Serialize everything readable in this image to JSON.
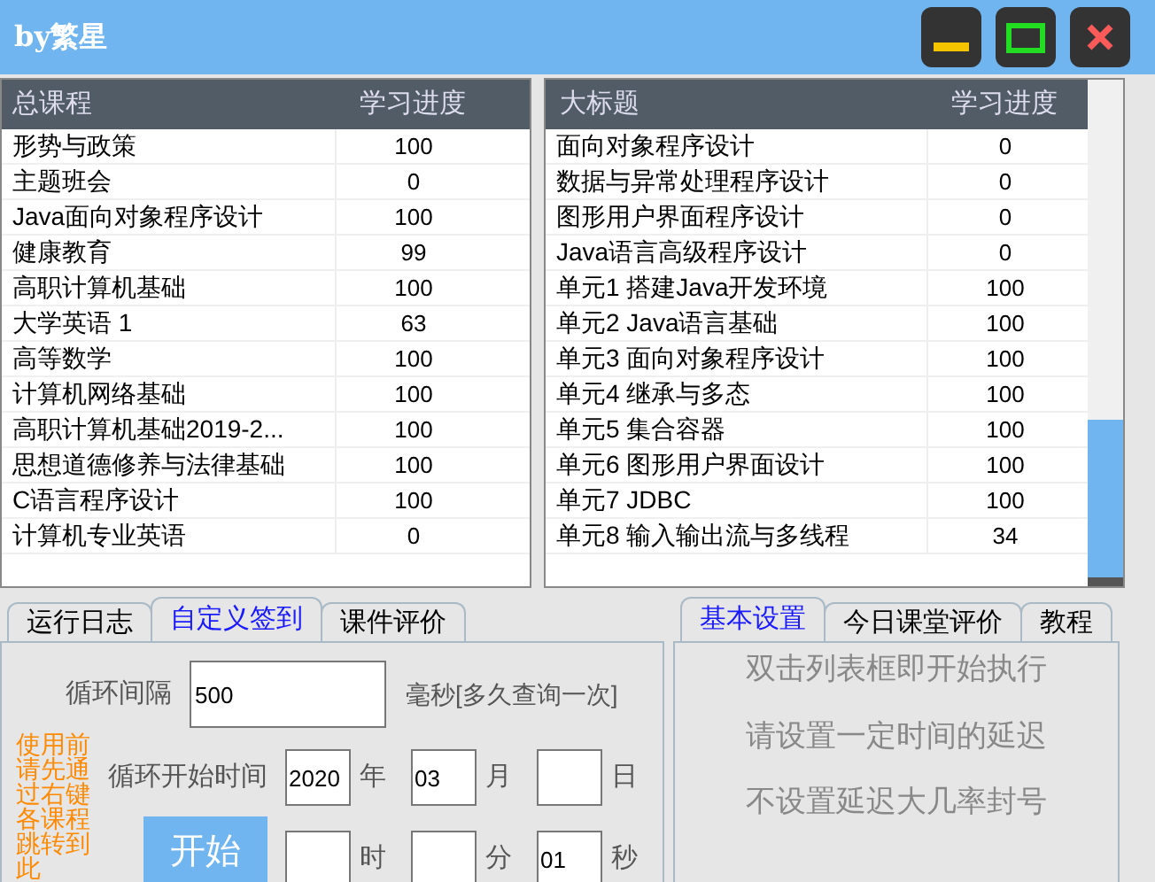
{
  "window": {
    "title": "by繁星"
  },
  "courses_table": {
    "columns": [
      "总课程",
      "学习进度"
    ],
    "rows": [
      {
        "name": "形势与政策",
        "progress": "100"
      },
      {
        "name": "主题班会",
        "progress": "0"
      },
      {
        "name": "Java面向对象程序设计",
        "progress": "100"
      },
      {
        "name": "健康教育",
        "progress": "99"
      },
      {
        "name": "高职计算机基础",
        "progress": "100"
      },
      {
        "name": "大学英语 1",
        "progress": "63"
      },
      {
        "name": "高等数学",
        "progress": "100"
      },
      {
        "name": "计算机网络基础",
        "progress": "100"
      },
      {
        "name": "高职计算机基础2019-2...",
        "progress": "100"
      },
      {
        "name": "思想道德修养与法律基础",
        "progress": "100"
      },
      {
        "name": "C语言程序设计",
        "progress": "100"
      },
      {
        "name": "计算机专业英语",
        "progress": "0"
      }
    ]
  },
  "chapters_table": {
    "columns": [
      "大标题",
      "学习进度"
    ],
    "rows": [
      {
        "name": "面向对象程序设计",
        "progress": "0"
      },
      {
        "name": "数据与异常处理程序设计",
        "progress": "0"
      },
      {
        "name": "图形用户界面程序设计",
        "progress": "0"
      },
      {
        "name": "Java语言高级程序设计",
        "progress": "0"
      },
      {
        "name": "单元1 搭建Java开发环境",
        "progress": "100"
      },
      {
        "name": "单元2 Java语言基础",
        "progress": "100"
      },
      {
        "name": "单元3 面向对象程序设计",
        "progress": "100"
      },
      {
        "name": "单元4 继承与多态",
        "progress": "100"
      },
      {
        "name": "单元5 集合容器",
        "progress": "100"
      },
      {
        "name": "单元6 图形用户界面设计",
        "progress": "100"
      },
      {
        "name": "单元7 JDBC",
        "progress": "100"
      },
      {
        "name": "单元8 输入输出流与多线程",
        "progress": "34"
      }
    ]
  },
  "left_panel": {
    "tabs": [
      {
        "label": "运行日志",
        "selected": false
      },
      {
        "label": "自定义签到",
        "selected": true
      },
      {
        "label": "课件评价",
        "selected": false
      }
    ],
    "interval": {
      "label": "循环间隔",
      "value": "500",
      "unit": "毫秒[多久查询一次]"
    },
    "note": "使用前请先通过右键各课程跳转到此",
    "start_time": {
      "label": "循环开始时间",
      "date_fields": [
        {
          "value": "2020",
          "unit": "年"
        },
        {
          "value": "03",
          "unit": "月"
        },
        {
          "unit": "日"
        }
      ],
      "time_fields": [
        {
          "unit": "时"
        },
        {
          "unit": "分"
        },
        {
          "value": "01",
          "unit": "秒"
        }
      ]
    },
    "start_button": "开始"
  },
  "right_panel": {
    "tabs": [
      {
        "label": "基本设置",
        "selected": true
      },
      {
        "label": "今日课堂评价",
        "selected": false
      },
      {
        "label": "教程",
        "selected": false
      }
    ],
    "lines": [
      "双击列表框即开始执行",
      "请设置一定时间的延迟",
      "不设置延迟大几率封号"
    ]
  }
}
